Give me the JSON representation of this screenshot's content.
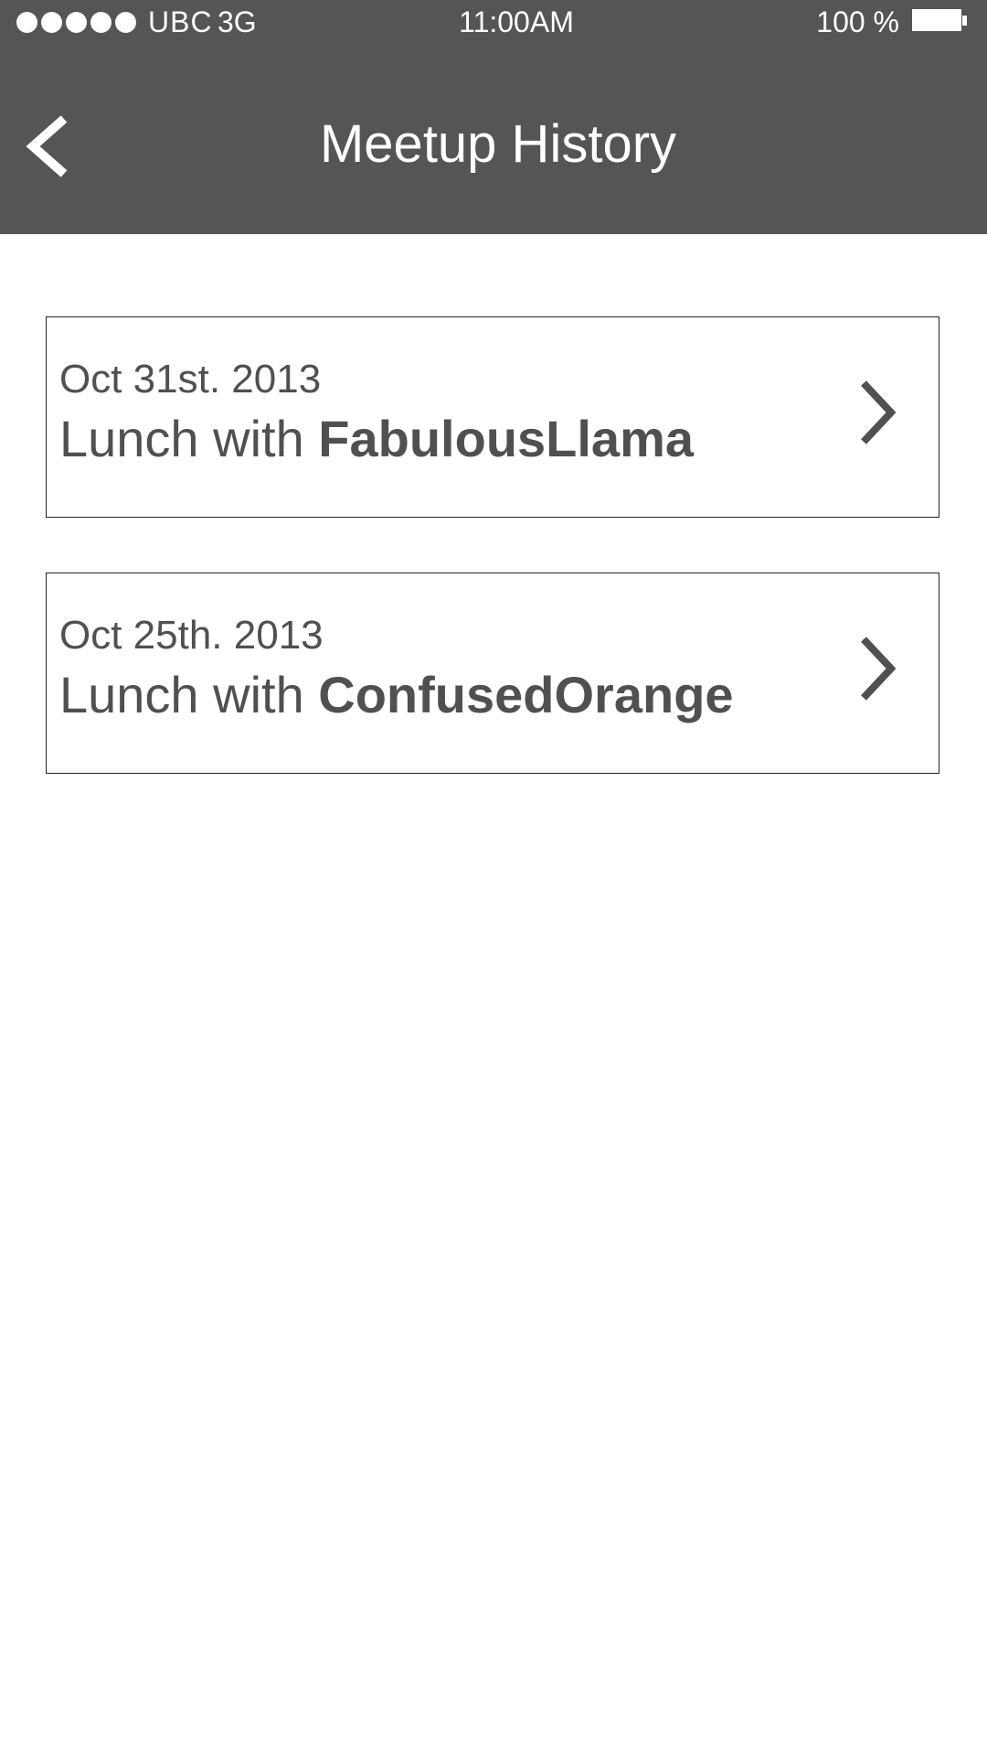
{
  "status_bar": {
    "signal_bars": 5,
    "carrier": "UBC",
    "network": "3G",
    "time": "11:00AM",
    "battery": "100 %",
    "battery_icon": "battery-full-icon"
  },
  "header": {
    "back_icon": "chevron-left-icon",
    "title": "Meetup History",
    "background_color": "#555555",
    "text_color": "#ffffff"
  },
  "meetups": [
    {
      "date": "Oct 31st. 2013",
      "prefix": "Lunch with ",
      "name": "FabulousLlama",
      "icon": "chevron-right-icon"
    },
    {
      "date": "Oct 25th. 2013",
      "prefix": "Lunch with ",
      "name": "ConfusedOrange",
      "icon": "chevron-right-icon"
    }
  ]
}
